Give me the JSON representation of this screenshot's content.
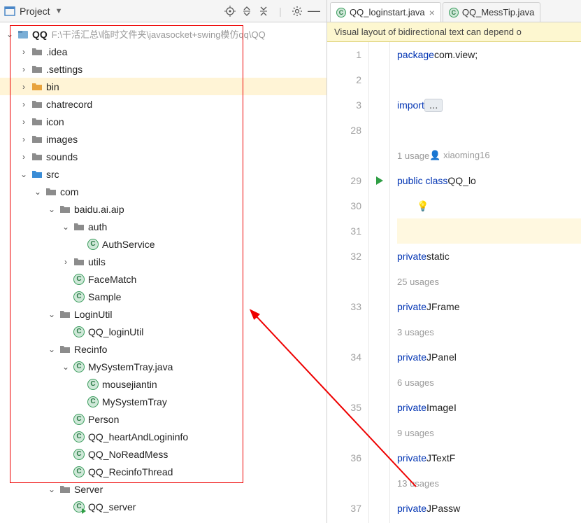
{
  "toolbar": {
    "title": "Project"
  },
  "tree": [
    {
      "d": 0,
      "e": "v",
      "i": "proj",
      "t": "QQ",
      "b": 1,
      "h": "F:\\干活汇总\\临时文件夹\\javasocket+swing模仿qq\\QQ"
    },
    {
      "d": 1,
      "e": ">",
      "i": "fg",
      "t": ".idea"
    },
    {
      "d": 1,
      "e": ">",
      "i": "fg",
      "t": ".settings"
    },
    {
      "d": 1,
      "e": ">",
      "i": "fo",
      "t": "bin",
      "sel": 1
    },
    {
      "d": 1,
      "e": ">",
      "i": "fg",
      "t": "chatrecord"
    },
    {
      "d": 1,
      "e": ">",
      "i": "fg",
      "t": "icon"
    },
    {
      "d": 1,
      "e": ">",
      "i": "fg",
      "t": "images"
    },
    {
      "d": 1,
      "e": ">",
      "i": "fg",
      "t": "sounds"
    },
    {
      "d": 1,
      "e": "v",
      "i": "fb",
      "t": "src"
    },
    {
      "d": 2,
      "e": "v",
      "i": "fg",
      "t": "com"
    },
    {
      "d": 3,
      "e": "v",
      "i": "fg",
      "t": "baidu.ai.aip"
    },
    {
      "d": 4,
      "e": "v",
      "i": "fg",
      "t": "auth"
    },
    {
      "d": 5,
      "e": "",
      "i": "c",
      "t": "AuthService"
    },
    {
      "d": 4,
      "e": ">",
      "i": "fg",
      "t": "utils"
    },
    {
      "d": 4,
      "e": "",
      "i": "c",
      "t": "FaceMatch"
    },
    {
      "d": 4,
      "e": "",
      "i": "c",
      "t": "Sample"
    },
    {
      "d": 3,
      "e": "v",
      "i": "fg",
      "t": "LoginUtil"
    },
    {
      "d": 4,
      "e": "",
      "i": "c",
      "t": "QQ_loginUtil"
    },
    {
      "d": 3,
      "e": "v",
      "i": "fg",
      "t": "Recinfo"
    },
    {
      "d": 4,
      "e": "v",
      "i": "c",
      "t": "MySystemTray.java"
    },
    {
      "d": 5,
      "e": "",
      "i": "c",
      "t": "mousejiantin"
    },
    {
      "d": 5,
      "e": "",
      "i": "c",
      "t": "MySystemTray"
    },
    {
      "d": 4,
      "e": "",
      "i": "c",
      "t": "Person"
    },
    {
      "d": 4,
      "e": "",
      "i": "c",
      "t": "QQ_heartAndLogininfo"
    },
    {
      "d": 4,
      "e": "",
      "i": "c",
      "t": "QQ_NoReadMess"
    },
    {
      "d": 4,
      "e": "",
      "i": "c",
      "t": "QQ_RecinfoThread"
    },
    {
      "d": 3,
      "e": "v",
      "i": "fg",
      "t": "Server"
    },
    {
      "d": 4,
      "e": "",
      "i": "cr",
      "t": "QQ_server"
    }
  ],
  "tabs": [
    {
      "name": "QQ_loginstart.java",
      "active": true,
      "close": true
    },
    {
      "name": "QQ_MessTip.java",
      "active": false,
      "close": false
    }
  ],
  "banner": "Visual layout of bidirectional text can depend o",
  "code": {
    "lines": [
      {
        "n": "1",
        "k": "package",
        "r": " com.view;"
      },
      {
        "n": "2"
      },
      {
        "n": "3",
        "k": "import",
        "fold": "..."
      },
      {
        "n": "28"
      },
      {
        "usage": "1 usage",
        "author": "xiaoming16"
      },
      {
        "n": "29",
        "run": 1,
        "k": "public class",
        "cls": " QQ_lo"
      },
      {
        "n": "30",
        "bulb": 1
      },
      {
        "n": "31",
        "hl": 1
      },
      {
        "n": "32",
        "k": "    private",
        "r": " static"
      },
      {
        "usage": "25 usages"
      },
      {
        "n": "33",
        "k": "    private",
        "r": " JFrame"
      },
      {
        "usage": "3 usages"
      },
      {
        "n": "34",
        "k": "    private",
        "r": " JPanel"
      },
      {
        "usage": "6 usages"
      },
      {
        "n": "35",
        "k": "    private",
        "r": " ImageI"
      },
      {
        "usage": "9 usages"
      },
      {
        "n": "36",
        "k": "    private",
        "r": " JTextF"
      },
      {
        "usage": "13 usages"
      },
      {
        "n": "37",
        "k": "    private",
        "r": " JPassw"
      }
    ]
  }
}
